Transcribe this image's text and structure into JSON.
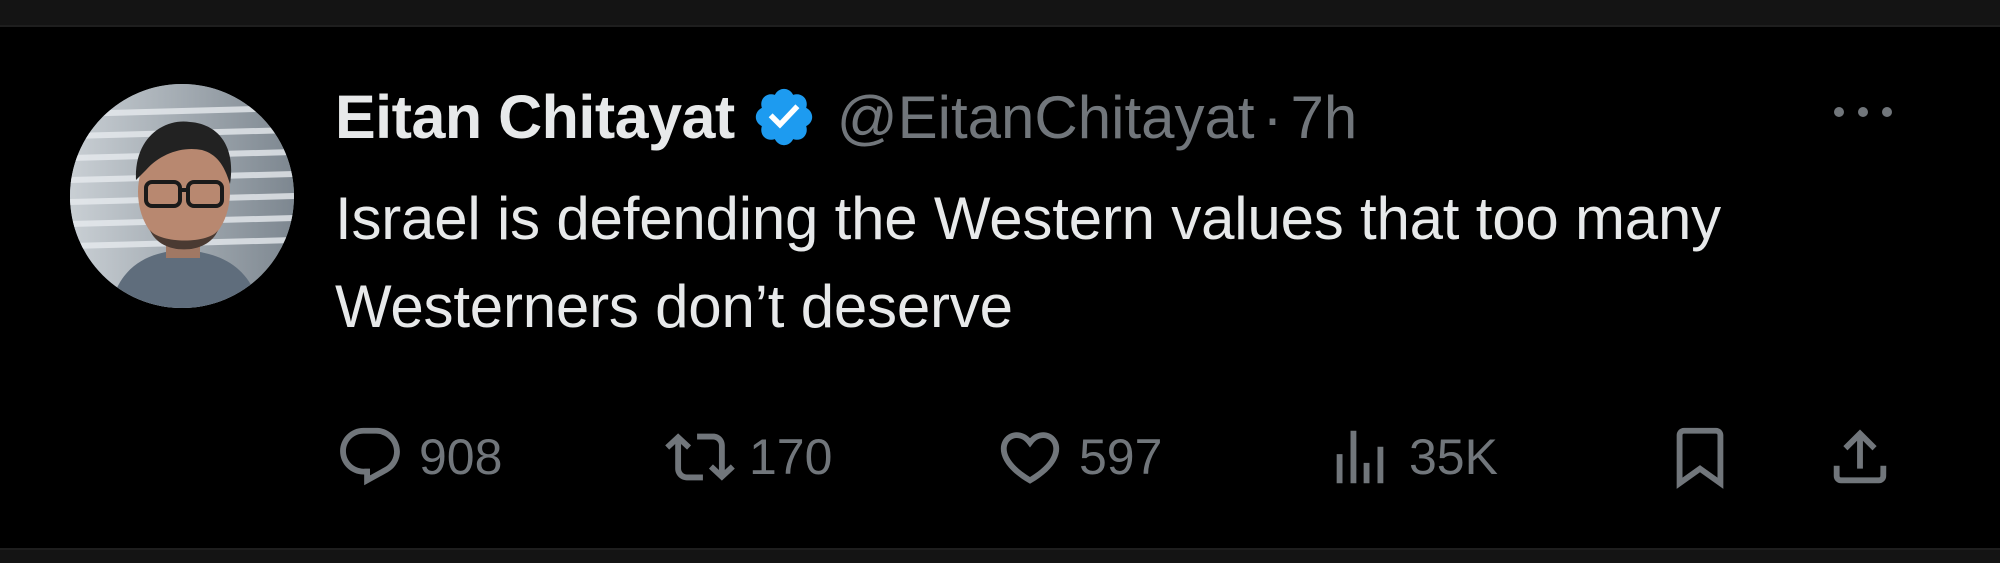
{
  "tweet": {
    "display_name": "Eitan Chitayat",
    "handle": "@EitanChitayat",
    "separator": "·",
    "time": "7h",
    "text": "Israel is defending the Western values that too many Westerners don’t deserve",
    "verified": true
  },
  "actions": {
    "replies": "908",
    "retweets": "170",
    "likes": "597",
    "views": "35K"
  },
  "icons": {
    "verified": "verified-badge-icon",
    "more": "more-options-icon",
    "reply": "reply-icon",
    "retweet": "retweet-icon",
    "like": "heart-icon",
    "views": "analytics-icon",
    "bookmark": "bookmark-icon",
    "share": "share-icon"
  },
  "colors": {
    "background": "#000000",
    "primary_text": "#e7e9ea",
    "secondary_text": "#71767b",
    "verified_blue": "#1d9bf0"
  }
}
